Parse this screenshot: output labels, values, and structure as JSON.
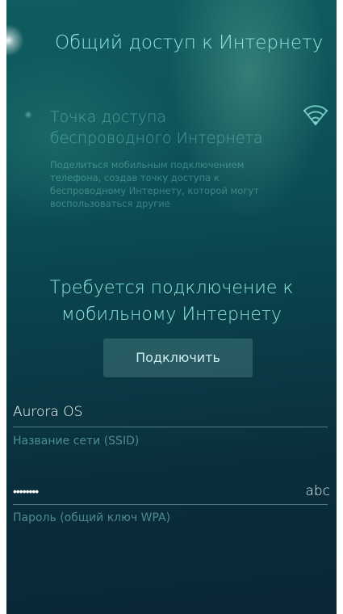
{
  "header": {
    "title": "Общий доступ к Интернету"
  },
  "hotspot": {
    "title_line1": "Точка доступа",
    "title_line2": "беспроводного Интернета",
    "description": "Поделиться мобильным подключением телефона, создав точку доступа к беспроводному Интернету, которой могут воспользоваться другие"
  },
  "connection": {
    "message_line1": "Требуется подключение к",
    "message_line2": "мобильному Интернету",
    "connect_label": "Подключить"
  },
  "ssid": {
    "value": "Aurora OS",
    "label": "Название сети (SSID)"
  },
  "password": {
    "value": "••••••••",
    "label": "Пароль (общий ключ WPA)",
    "mode_toggle": "abc"
  },
  "colors": {
    "accent": "#8ee6e0",
    "background_top": "#0f5d60",
    "background_bottom": "#0b2636"
  },
  "icons": {
    "hotspot": "wifi-hotspot-icon"
  }
}
